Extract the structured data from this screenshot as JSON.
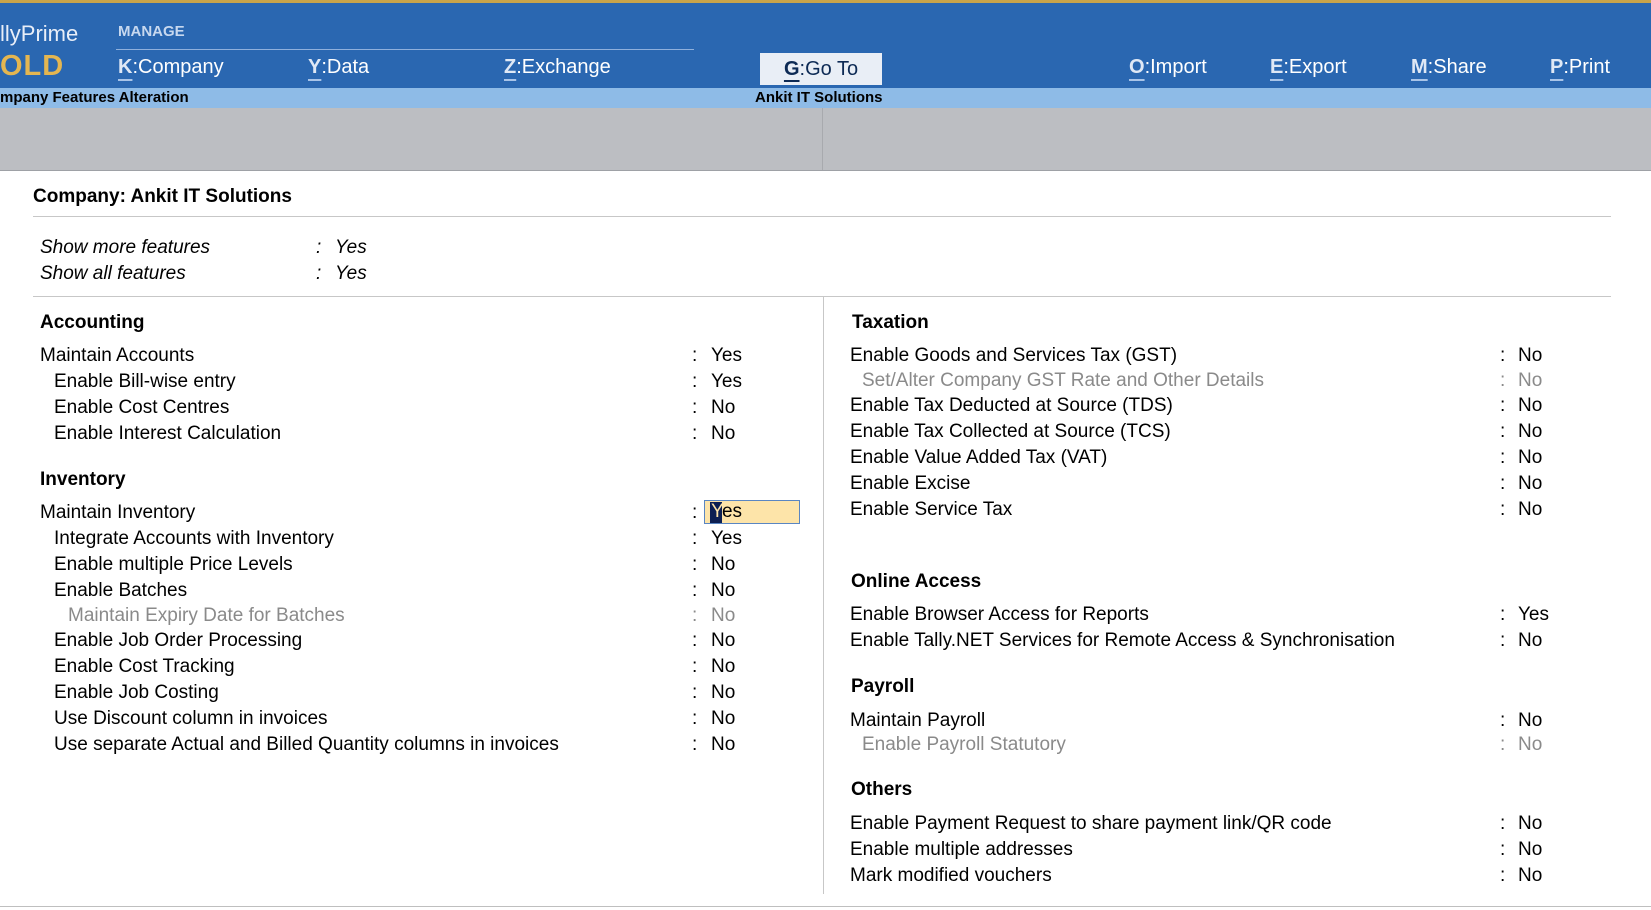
{
  "app": {
    "brand_top": "llyPrime",
    "brand_edition": "OLD"
  },
  "menu": {
    "manage_label": "MANAGE",
    "company": {
      "key": "K",
      "label": "Company"
    },
    "data": {
      "key": "Y",
      "label": "Data"
    },
    "exchange": {
      "key": "Z",
      "label": "Exchange"
    },
    "goto": {
      "key": "G",
      "label": "Go To"
    },
    "import": {
      "key": "O",
      "label": "Import"
    },
    "export": {
      "key": "E",
      "label": "Export"
    },
    "share": {
      "key": "M",
      "label": "Share"
    },
    "print": {
      "key": "P",
      "label": "Print"
    },
    "separator": ":"
  },
  "subbar": {
    "screen_title": "mpany Features  Alteration",
    "company_name": "Ankit IT Solutions"
  },
  "form": {
    "company_title": "Company: Ankit IT Solutions",
    "colon": ":",
    "show_more": {
      "label": "Show more features",
      "value": "Yes"
    },
    "show_all": {
      "label": "Show all features",
      "value": "Yes"
    },
    "accounting": {
      "heading": "Accounting",
      "items": [
        {
          "label": "Maintain Accounts",
          "value": "Yes"
        },
        {
          "label": "Enable Bill-wise entry",
          "value": "Yes"
        },
        {
          "label": "Enable Cost Centres",
          "value": "No"
        },
        {
          "label": "Enable Interest Calculation",
          "value": "No"
        }
      ]
    },
    "inventory": {
      "heading": "Inventory",
      "items": [
        {
          "label": "Maintain Inventory",
          "value_first": "Y",
          "value_rest": "es"
        },
        {
          "label": "Integrate Accounts with Inventory",
          "value": "Yes"
        },
        {
          "label": "Enable multiple Price Levels",
          "value": "No"
        },
        {
          "label": "Enable Batches",
          "value": "No"
        },
        {
          "label": "Maintain Expiry Date for Batches",
          "value": "No"
        },
        {
          "label": "Enable Job Order Processing",
          "value": "No"
        },
        {
          "label": "Enable Cost Tracking",
          "value": "No"
        },
        {
          "label": "Enable Job Costing",
          "value": "No"
        },
        {
          "label": "Use Discount column in invoices",
          "value": "No"
        },
        {
          "label": "Use separate Actual and Billed Quantity columns in invoices",
          "value": "No"
        }
      ]
    },
    "taxation": {
      "heading": "Taxation",
      "items": [
        {
          "label": "Enable Goods and Services Tax (GST)",
          "value": "No"
        },
        {
          "label": "Set/Alter Company GST Rate and Other Details",
          "value": "No"
        },
        {
          "label": "Enable Tax Deducted at Source (TDS)",
          "value": "No"
        },
        {
          "label": "Enable Tax Collected at Source (TCS)",
          "value": "No"
        },
        {
          "label": "Enable Value Added Tax (VAT)",
          "value": "No"
        },
        {
          "label": "Enable Excise",
          "value": "No"
        },
        {
          "label": "Enable Service Tax",
          "value": "No"
        }
      ]
    },
    "online_access": {
      "heading": "Online Access",
      "items": [
        {
          "label": "Enable Browser Access for Reports",
          "value": "Yes"
        },
        {
          "label": "Enable Tally.NET Services for Remote Access & Synchronisation",
          "value": "No"
        }
      ]
    },
    "payroll": {
      "heading": "Payroll",
      "items": [
        {
          "label": "Maintain Payroll",
          "value": "No"
        },
        {
          "label": "Enable Payroll Statutory",
          "value": "No"
        }
      ]
    },
    "others": {
      "heading": "Others",
      "items": [
        {
          "label": "Enable Payment Request to share payment link/QR code",
          "value": "No"
        },
        {
          "label": "Enable multiple addresses",
          "value": "No"
        },
        {
          "label": "Mark modified vouchers",
          "value": "No"
        }
      ]
    }
  },
  "colors": {
    "topbar": "#2a67b1",
    "subbar": "#8ebbe7",
    "edit_highlight": "#fde4a9",
    "disabled_text": "#8a8a8a"
  }
}
